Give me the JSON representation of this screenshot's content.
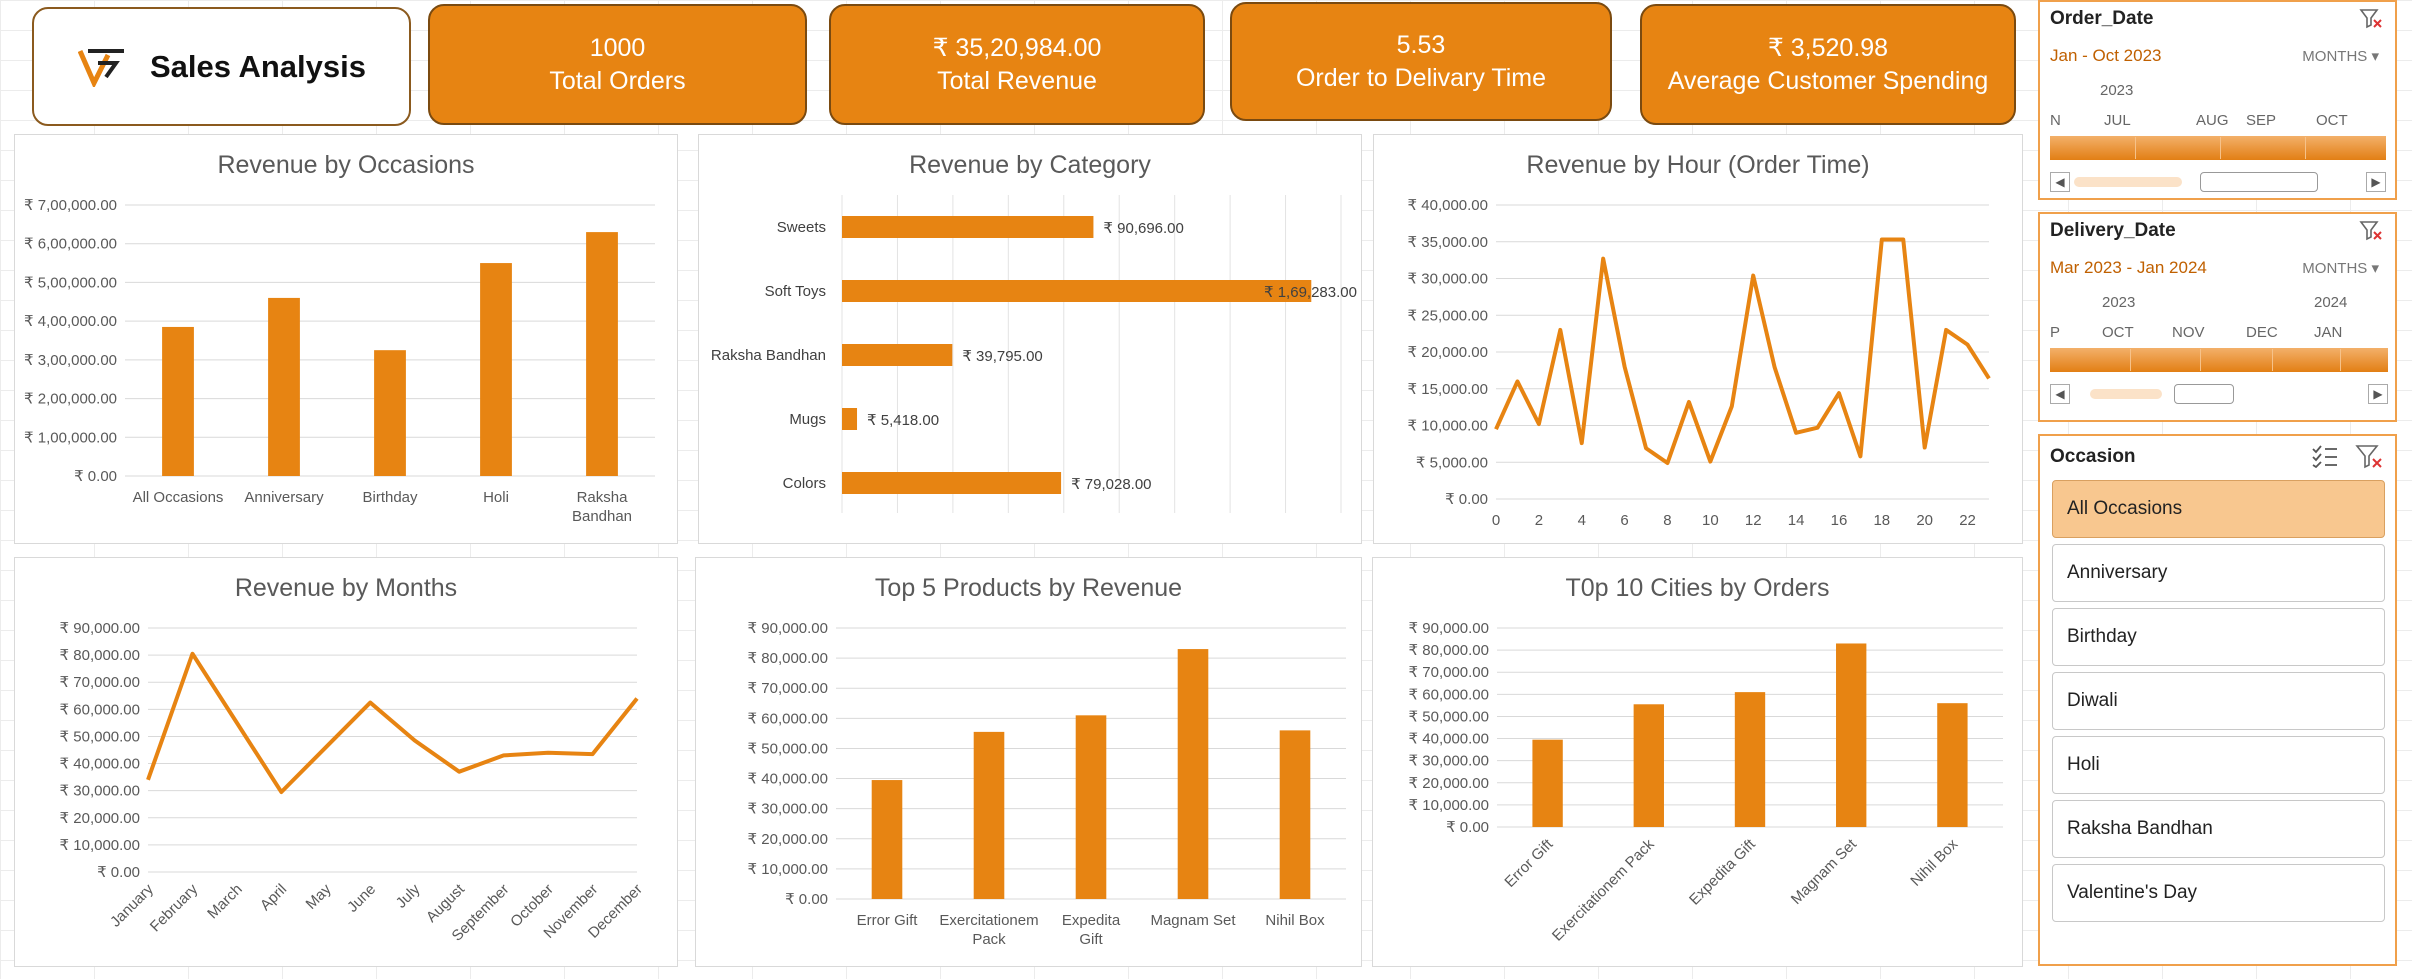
{
  "header": {
    "title": "Sales Analysis",
    "kpis": [
      {
        "value": "1000",
        "label": "Total Orders"
      },
      {
        "value": "₹ 35,20,984.00",
        "label": "Total Revenue"
      },
      {
        "value": "5.53",
        "label": "Order to Delivary Time"
      },
      {
        "value": "₹ 3,520.98",
        "label": "Average Customer Spending"
      }
    ]
  },
  "colors": {
    "accent": "#e78412",
    "accent_dark": "#7a4a10",
    "slicer_border": "#f0a04b",
    "selected": "#f8c78f"
  },
  "charts": {
    "occasions": {
      "title": "Revenue by Occasions",
      "yticks": [
        "₹ 7,00,000.00",
        "₹ 6,00,000.00",
        "₹ 5,00,000.00",
        "₹ 4,00,000.00",
        "₹ 3,00,000.00",
        "₹ 2,00,000.00",
        "₹ 1,00,000.00",
        "₹ 0.00"
      ]
    },
    "category": {
      "title": "Revenue by Category"
    },
    "hour": {
      "title": "Revenue by Hour (Order Time)",
      "yticks": [
        "₹ 40,000.00",
        "₹ 35,000.00",
        "₹ 30,000.00",
        "₹ 25,000.00",
        "₹ 20,000.00",
        "₹ 15,000.00",
        "₹ 10,000.00",
        "₹ 5,000.00",
        "₹ 0.00"
      ]
    },
    "months": {
      "title": "Revenue by Months",
      "yticks": [
        "₹ 90,000.00",
        "₹ 80,000.00",
        "₹ 70,000.00",
        "₹ 60,000.00",
        "₹ 50,000.00",
        "₹ 40,000.00",
        "₹ 30,000.00",
        "₹ 20,000.00",
        "₹ 10,000.00",
        "₹ 0.00"
      ]
    },
    "products": {
      "title": "Top 5 Products by Revenue",
      "yticks": [
        "₹ 90,000.00",
        "₹ 80,000.00",
        "₹ 70,000.00",
        "₹ 60,000.00",
        "₹ 50,000.00",
        "₹ 40,000.00",
        "₹ 30,000.00",
        "₹ 20,000.00",
        "₹ 10,000.00",
        "₹ 0.00"
      ]
    },
    "cities": {
      "title": "T0p 10 Cities by Orders",
      "yticks": [
        "₹ 90,000.00",
        "₹ 80,000.00",
        "₹ 70,000.00",
        "₹ 60,000.00",
        "₹ 50,000.00",
        "₹ 40,000.00",
        "₹ 30,000.00",
        "₹ 20,000.00",
        "₹ 10,000.00",
        "₹ 0.00"
      ]
    }
  },
  "chart_data": [
    {
      "id": "occasions",
      "type": "bar",
      "title": "Revenue by Occasions",
      "categories": [
        "All Occasions",
        "Anniversary",
        "Birthday",
        "Holi",
        "Raksha Bandhan"
      ],
      "values": [
        385000,
        460000,
        325000,
        550000,
        630000
      ],
      "ylim": [
        0,
        700000
      ],
      "grid": true
    },
    {
      "id": "category",
      "type": "bar",
      "orientation": "horizontal",
      "title": "Revenue by Category",
      "categories": [
        "Sweets",
        "Soft Toys",
        "Raksha Bandhan",
        "Mugs",
        "Colors"
      ],
      "values": [
        90696,
        169283,
        39795,
        5418,
        79028
      ],
      "data_labels": [
        "₹ 90,696.00",
        "₹ 1,69,283.00",
        "₹ 39,795.00",
        "₹ 5,418.00",
        "₹ 79,028.00"
      ],
      "grid": true
    },
    {
      "id": "hour",
      "type": "line",
      "title": "Revenue by Hour (Order Time)",
      "x": [
        0,
        1,
        2,
        3,
        4,
        5,
        6,
        7,
        8,
        9,
        10,
        11,
        12,
        13,
        14,
        15,
        16,
        17,
        18,
        19,
        20,
        21,
        22,
        23
      ],
      "xticks": [
        "0",
        "2",
        "4",
        "6",
        "8",
        "10",
        "12",
        "14",
        "16",
        "18",
        "20",
        "22"
      ],
      "values": [
        9500,
        16000,
        10200,
        23000,
        7600,
        32700,
        18000,
        6900,
        4900,
        13200,
        5100,
        12600,
        30400,
        17900,
        9000,
        9700,
        14400,
        5800,
        35300,
        35300,
        7000,
        23000,
        21000,
        16400
      ],
      "ylim": [
        0,
        40000
      ],
      "grid": true
    },
    {
      "id": "months",
      "type": "line",
      "title": "Revenue by Months",
      "categories": [
        "January",
        "February",
        "March",
        "April",
        "May",
        "June",
        "July",
        "August",
        "September",
        "October",
        "November",
        "December"
      ],
      "values": [
        34000,
        80500,
        55000,
        29500,
        46000,
        62500,
        48500,
        37000,
        43000,
        44000,
        43500,
        64000
      ],
      "ylim": [
        0,
        90000
      ],
      "grid": true
    },
    {
      "id": "products",
      "type": "bar",
      "title": "Top 5 Products by Revenue",
      "categories": [
        "Error Gift",
        "Exercitationem Pack",
        "Expedita Gift",
        "Magnam Set",
        "Nihil Box"
      ],
      "values": [
        39500,
        55500,
        61000,
        83000,
        56000
      ],
      "ylim": [
        0,
        90000
      ],
      "grid": true
    },
    {
      "id": "cities",
      "type": "bar",
      "title": "T0p 10 Cities by Orders",
      "categories": [
        "Error Gift",
        "Exercitationem Pack",
        "Expedita Gift",
        "Magnam Set",
        "Nihil Box"
      ],
      "values": [
        39500,
        55500,
        61000,
        83000,
        56000
      ],
      "ylim": [
        0,
        90000
      ],
      "grid": true
    }
  ],
  "slicers": {
    "order_date": {
      "title": "Order_Date",
      "range": "Jan - Oct 2023",
      "level": "MONTHS",
      "years": [
        "2023"
      ],
      "months": [
        "N",
        "JUL",
        "AUG",
        "SEP",
        "OCT"
      ]
    },
    "delivery_date": {
      "title": "Delivery_Date",
      "range": "Mar 2023 - Jan 2024",
      "level": "MONTHS",
      "years": [
        "2023",
        "2024"
      ],
      "months": [
        "P",
        "OCT",
        "NOV",
        "DEC",
        "JAN"
      ]
    },
    "occasion": {
      "title": "Occasion",
      "items": [
        "All Occasions",
        "Anniversary",
        "Birthday",
        "Diwali",
        "Holi",
        "Raksha Bandhan",
        "Valentine's Day"
      ],
      "selected": "All Occasions"
    }
  },
  "icons": {
    "filter_clear": "filter-clear-icon",
    "multi_select": "multi-select-icon",
    "logo": "logo-icon"
  }
}
